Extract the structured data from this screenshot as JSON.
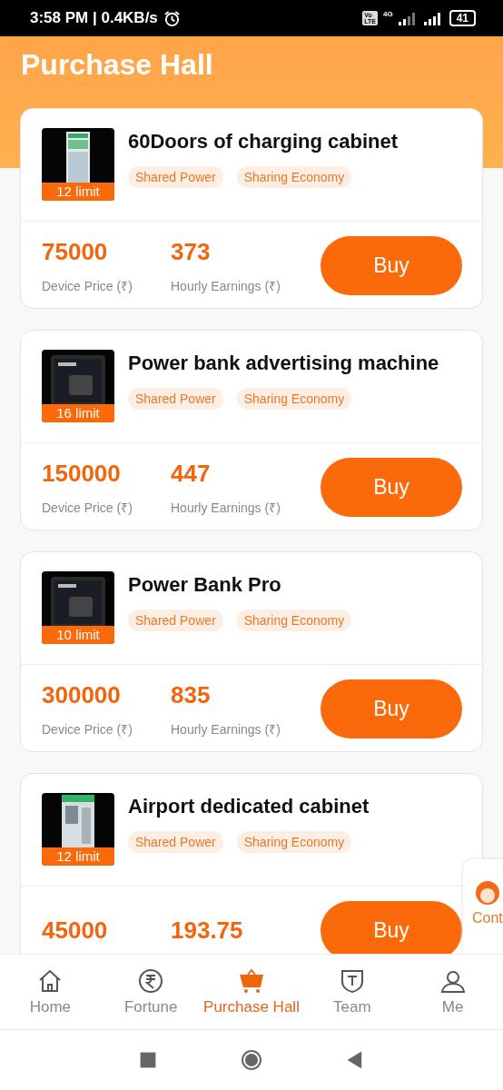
{
  "status_bar": {
    "time": "3:58 PM | 0.4KB/s",
    "volte": [
      "Vo",
      "LTE"
    ],
    "network": "4G",
    "battery": "41"
  },
  "header": {
    "title": "Purchase Hall"
  },
  "products": [
    {
      "name": "60Doors of charging cabinet",
      "limit": "12 limit",
      "tags": [
        "Shared Power",
        "Sharing Economy"
      ],
      "price": "75000",
      "price_label": "Device Price (₹)",
      "earnings": "373",
      "earnings_label": "Hourly Earnings (₹)",
      "button": "Buy"
    },
    {
      "name": "Power bank advertising machine",
      "limit": "16 limit",
      "tags": [
        "Shared Power",
        "Sharing Economy"
      ],
      "price": "150000",
      "price_label": "Device Price (₹)",
      "earnings": "447",
      "earnings_label": "Hourly Earnings (₹)",
      "button": "Buy"
    },
    {
      "name": "Power Bank Pro",
      "limit": "10 limit",
      "tags": [
        "Shared Power",
        "Sharing Economy"
      ],
      "price": "300000",
      "price_label": "Device Price (₹)",
      "earnings": "835",
      "earnings_label": "Hourly Earnings (₹)",
      "button": "Buy"
    },
    {
      "name": "Airport dedicated cabinet",
      "limit": "12 limit",
      "tags": [
        "Shared Power",
        "Sharing Economy"
      ],
      "price": "45000",
      "earnings": "193.75",
      "button": "Buy"
    }
  ],
  "contact_button": {
    "label": "Cont"
  },
  "bottom_nav": [
    {
      "label": "Home",
      "selected": false
    },
    {
      "label": "Fortune",
      "selected": false
    },
    {
      "label": "Purchase Hall",
      "selected": true
    },
    {
      "label": "Team",
      "selected": false
    },
    {
      "label": "Me",
      "selected": false
    }
  ]
}
